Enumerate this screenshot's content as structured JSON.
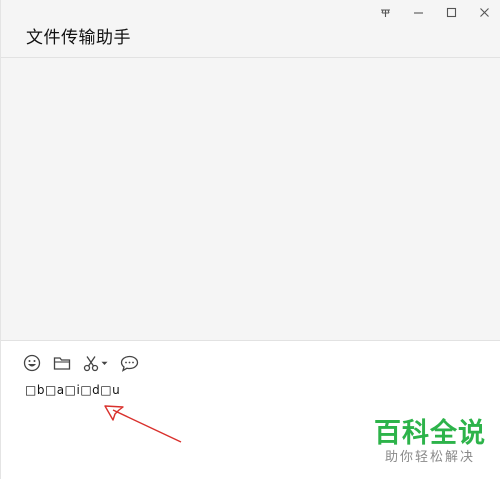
{
  "window": {
    "title": "文件传输助手",
    "controls": [
      "pin",
      "minimize",
      "maximize",
      "close"
    ]
  },
  "toolbar": {
    "icons": [
      "emoji-icon",
      "folder-icon",
      "scissors-icon",
      "chat-bubble-icon"
    ]
  },
  "input": {
    "value": "□b□a□i□d□u"
  },
  "watermark": {
    "title": "百科全说",
    "subtitle": "助你轻松解决",
    "color": "#2db34a"
  },
  "annotation": {
    "arrow_color": "#d9302c"
  }
}
